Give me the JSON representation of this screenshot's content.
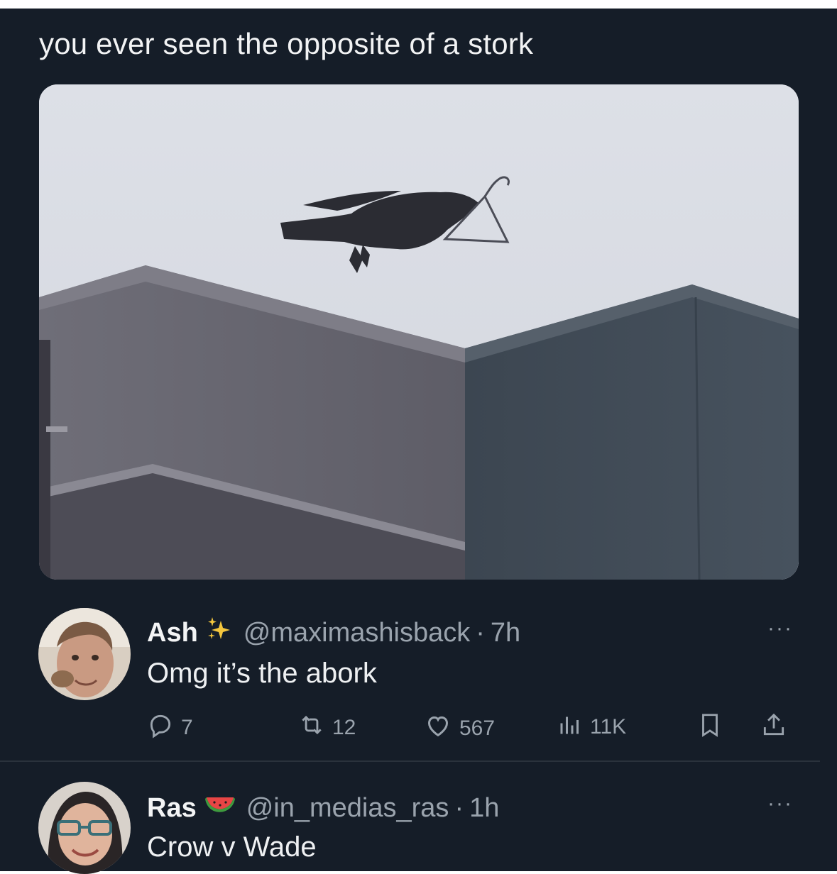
{
  "post": {
    "text": "you ever seen the opposite of a stork"
  },
  "replies": [
    {
      "name": "Ash",
      "emoji_icon": "sparkles-icon",
      "handle": "@maximashisback",
      "separator": "·",
      "time": "7h",
      "text": "Omg it’s the abork",
      "more": "···",
      "stats": {
        "replies": "7",
        "reposts": "12",
        "likes": "567",
        "views": "11K"
      }
    },
    {
      "name": "Ras",
      "emoji_icon": "watermelon-icon",
      "handle": "@in_medias_ras",
      "separator": "·",
      "time": "1h",
      "text": "Crow v Wade",
      "more": "···"
    }
  ],
  "colors": {
    "background": "#151d28",
    "text": "#e7e9ea",
    "muted": "#9aa3ad",
    "sparkle": "#f4c63d"
  }
}
